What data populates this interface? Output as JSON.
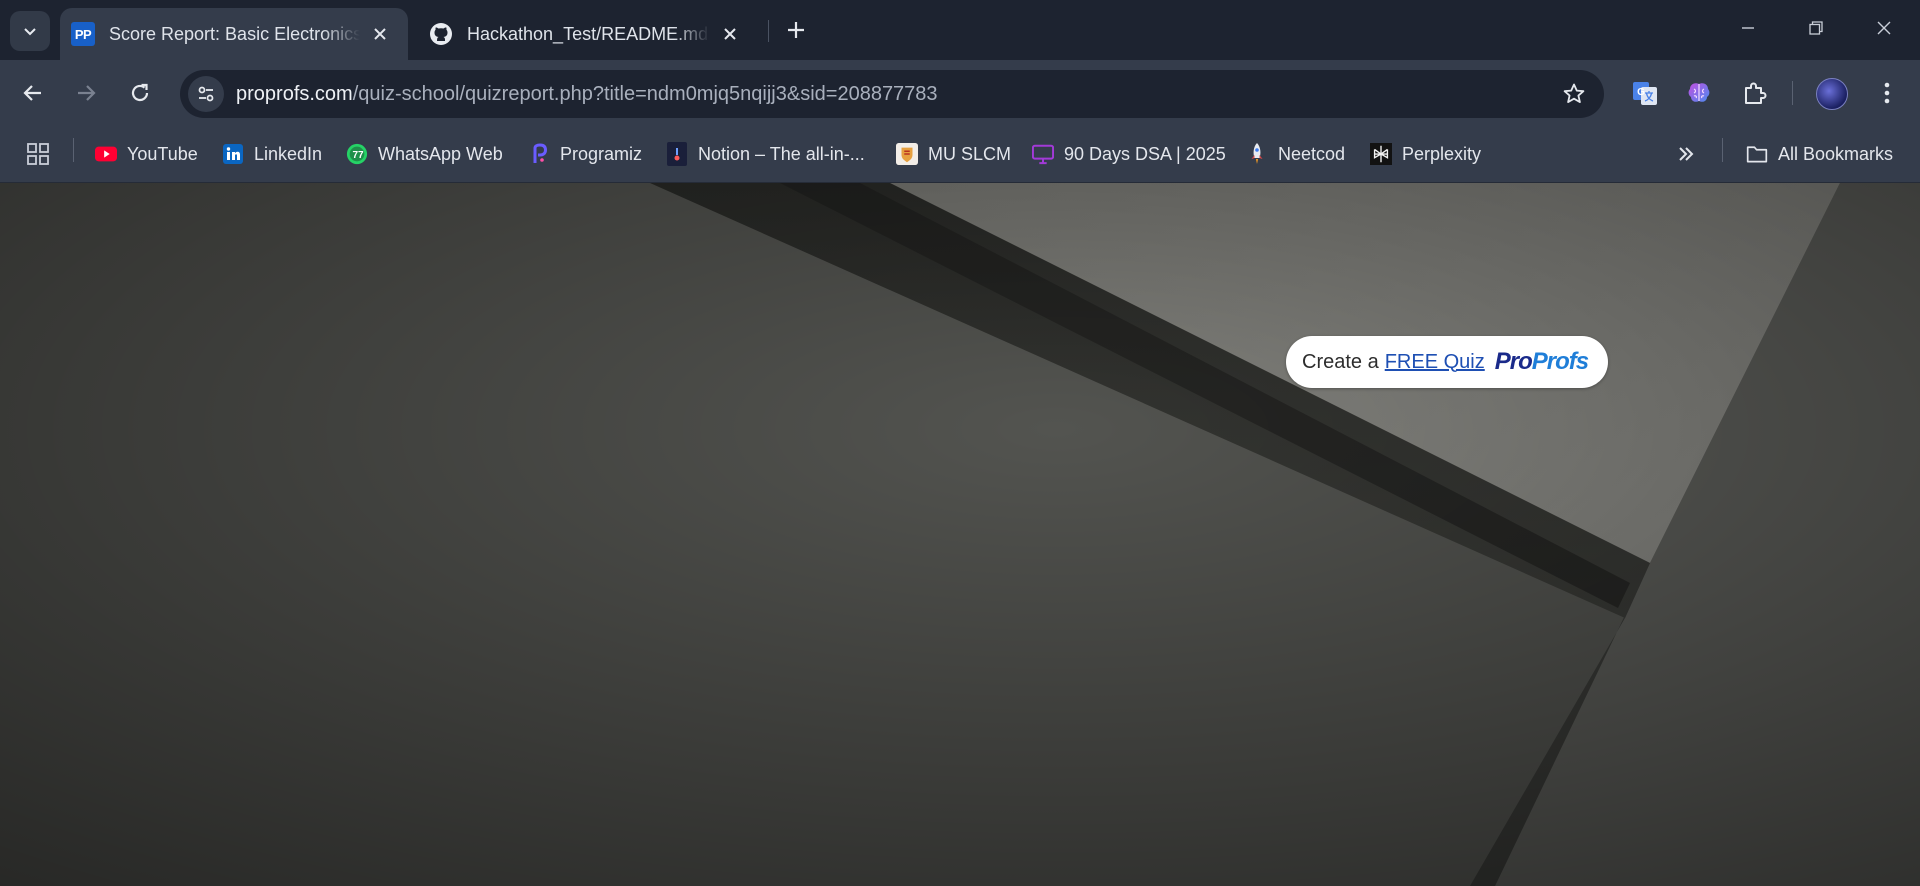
{
  "tabs": [
    {
      "title": "Score Report: Basic Electronics Q",
      "favicon": "PP",
      "active": true
    },
    {
      "title": "Hackathon_Test/README.md at main",
      "favicon": "github-icon",
      "active": false
    }
  ],
  "toolbar": {
    "url_host": "proprofs.com",
    "url_path": "/quiz-school/quizreport.php?title=ndm0mjq5nqijj3&sid=208877783"
  },
  "bookmarks": [
    {
      "label": "YouTube",
      "icon": "youtube-icon"
    },
    {
      "label": "LinkedIn",
      "icon": "linkedin-icon"
    },
    {
      "label": "WhatsApp Web",
      "icon": "whatsapp-icon"
    },
    {
      "label": "Programiz",
      "icon": "programiz-icon"
    },
    {
      "label": "Notion – The all-in-...",
      "icon": "notion-icon"
    },
    {
      "label": "MU SLCM",
      "icon": "mu-slcm-icon"
    },
    {
      "label": "90 Days DSA | 2025",
      "icon": "dsa-icon"
    },
    {
      "label": "Neetcod",
      "icon": "rocket-icon"
    },
    {
      "label": "Perplexity",
      "icon": "perplexity-icon"
    }
  ],
  "all_bookmarks_label": "All Bookmarks",
  "whatsapp_badge": "77",
  "cta": {
    "prefix": "Create a",
    "link": "FREE Quiz",
    "logo_pro": "Pro",
    "logo_profs": "Profs"
  },
  "colors": {
    "tabstrip_bg": "#1d2330",
    "toolbar_bg": "#343c4b",
    "link_blue": "#1e4fb3",
    "content_bg": "#525350"
  }
}
